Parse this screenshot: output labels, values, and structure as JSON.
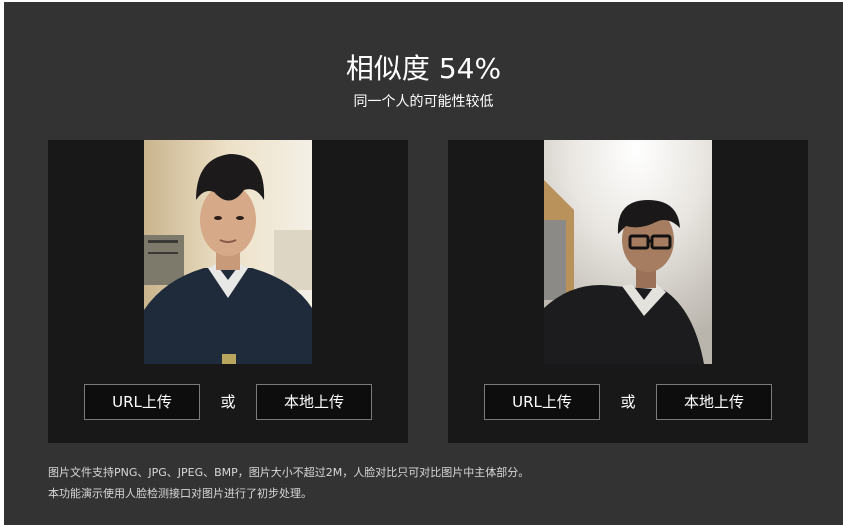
{
  "result": {
    "title": "相似度 54%",
    "subtitle": "同一个人的可能性较低",
    "similarity_percent": 54
  },
  "cards": [
    {
      "url_button": "URL上传",
      "or_text": "或",
      "local_button": "本地上传"
    },
    {
      "url_button": "URL上传",
      "or_text": "或",
      "local_button": "本地上传"
    }
  ],
  "notes": [
    "图片文件支持PNG、JPG、JPEG、BMP，图片大小不超过2M，人脸对比只可对比图片中主体部分。",
    "本功能演示使用人脸检测接口对图片进行了初步处理。"
  ],
  "colors": {
    "panel_bg": "#333333",
    "card_bg": "#181818",
    "button_bg": "#0d0d0d",
    "button_border": "#7a7a7a",
    "text": "#ffffff"
  }
}
